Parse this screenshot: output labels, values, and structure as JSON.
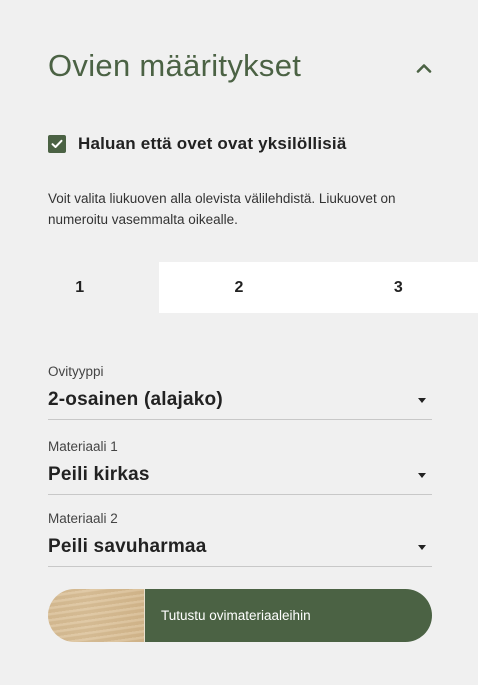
{
  "section": {
    "title": "Ovien määritykset"
  },
  "unique_doors": {
    "checked": true,
    "label": "Haluan että ovet ovat yksilöllisiä"
  },
  "help_text": "Voit valita liukuoven alla olevista välilehdistä. Liukuovet on numeroitu vasemmalta oikealle.",
  "tabs": [
    {
      "label": "1",
      "active": true
    },
    {
      "label": "2",
      "active": false
    },
    {
      "label": "3",
      "active": false
    }
  ],
  "fields": {
    "door_type": {
      "label": "Ovityyppi",
      "value": "2-osainen (alajako)"
    },
    "material_1": {
      "label": "Materiaali 1",
      "value": "Peili kirkas"
    },
    "material_2": {
      "label": "Materiaali 2",
      "value": "Peili savuharmaa"
    }
  },
  "materials_button": {
    "label": "Tutustu ovimateriaaleihin"
  },
  "colors": {
    "accent": "#4b6244",
    "panel_background": "#f0f0f0"
  }
}
